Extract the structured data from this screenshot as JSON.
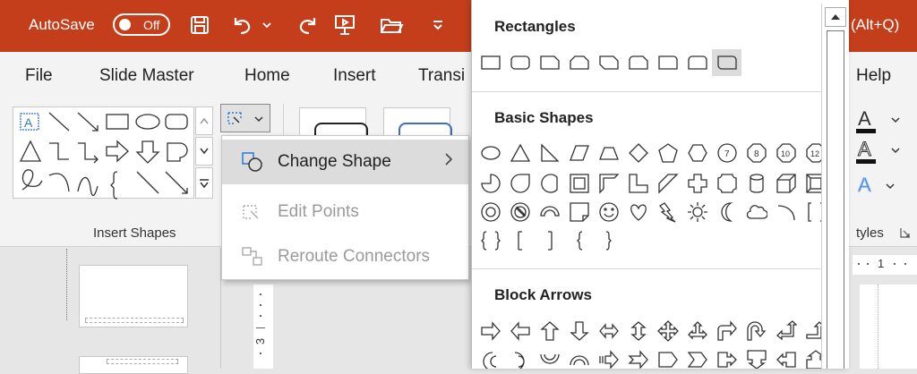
{
  "titlebar": {
    "autosave_label": "AutoSave",
    "autosave_state": "Off",
    "search_hint": "(Alt+Q)",
    "quick_access": [
      {
        "icon": "save-icon"
      },
      {
        "icon": "undo-icon"
      },
      {
        "icon": "undo-dropdown-icon"
      },
      {
        "icon": "redo-icon"
      },
      {
        "icon": "present-from-beginning-icon"
      },
      {
        "icon": "open-folder-icon"
      },
      {
        "icon": "customize-qat-icon"
      }
    ]
  },
  "tabs": [
    "File",
    "Slide Master",
    "Home",
    "Insert",
    "Transi",
    "Help"
  ],
  "ribbon": {
    "insert_shapes_label": "Insert Shapes",
    "styles_label": "tyles"
  },
  "context_menu": {
    "items": [
      {
        "label": "Change Shape",
        "icon": "change-shape-icon",
        "enabled": true,
        "submenu": true
      },
      {
        "label": "Edit Points",
        "icon": "edit-points-icon",
        "enabled": false,
        "submenu": false
      },
      {
        "label": "Reroute Connectors",
        "icon": "reroute-connectors-icon",
        "enabled": false,
        "submenu": false
      }
    ]
  },
  "shapes_panel": {
    "categories": [
      {
        "name": "Rectangles",
        "selected_index": 8
      },
      {
        "name": "Basic Shapes"
      },
      {
        "name": "Block Arrows"
      }
    ],
    "octagon_labels": [
      "7",
      "8",
      "10",
      "12"
    ]
  },
  "ruler": {
    "top_mark": "1",
    "left_mark": "3"
  }
}
